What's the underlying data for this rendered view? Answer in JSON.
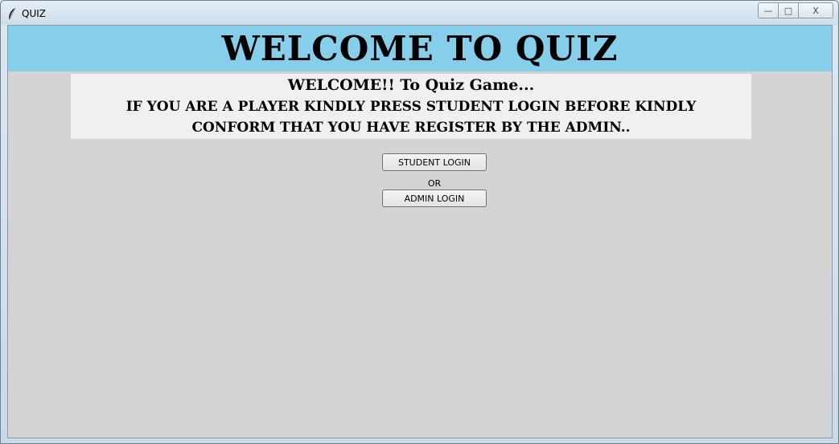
{
  "window": {
    "title": "QUIZ",
    "icon": "feather-icon",
    "controls": {
      "minimize": "—",
      "maximize": "□",
      "close": "X"
    }
  },
  "header": {
    "title": "WELCOME TO QUIZ",
    "background": "#87ceeb"
  },
  "welcome": {
    "line1": "WELCOME!! To Quiz Game...",
    "line2": "IF YOU ARE A PLAYER KINDLY PRESS STUDENT LOGIN BEFORE KINDLY",
    "line3": "CONFORM THAT YOU HAVE REGISTER BY THE ADMIN.."
  },
  "actions": {
    "student_login": "STUDENT LOGIN",
    "or_label": "OR",
    "admin_login": "ADMIN LOGIN"
  }
}
